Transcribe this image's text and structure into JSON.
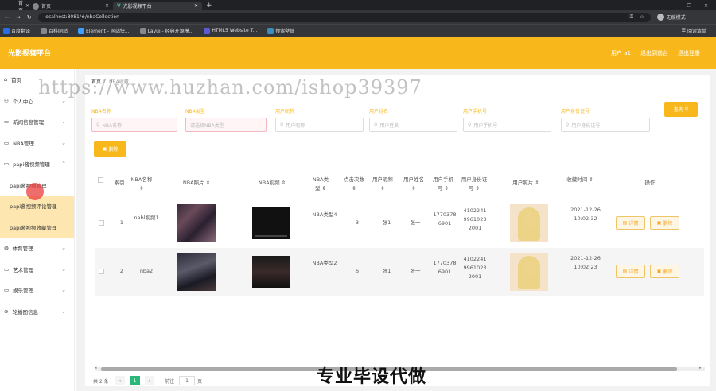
{
  "browser": {
    "tabs": [
      {
        "label": "首页"
      },
      {
        "label": "首页"
      },
      {
        "label": "光影视频平台"
      }
    ],
    "url": "localhost:8081/#/nbaCollection",
    "incognito": "无痕模式",
    "bookmarks": [
      {
        "label": "百度翻译"
      },
      {
        "label": "百科网站"
      },
      {
        "label": "Element - 网站快..."
      },
      {
        "label": "Layui - 经典开源模..."
      },
      {
        "label": "HTML5 Website T..."
      },
      {
        "label": "搜索壁纸"
      }
    ],
    "reading_list": "阅读清单"
  },
  "header": {
    "brand": "光影视频平台",
    "user": "用户 a1",
    "back": "退出到前台",
    "logout": "退出登录"
  },
  "sidebar": [
    {
      "label": "首页"
    },
    {
      "label": "个人中心"
    },
    {
      "label": "新闻信息管理"
    },
    {
      "label": "NBA管理"
    },
    {
      "label": "papi酱视频管理"
    },
    {
      "label": "papi酱视频管理"
    },
    {
      "label": "papi酱视频评论管理"
    },
    {
      "label": "papi酱视频收藏管理"
    },
    {
      "label": "体育管理"
    },
    {
      "label": "艺术管理"
    },
    {
      "label": "娱乐管理"
    },
    {
      "label": "轮播图信息"
    }
  ],
  "breadcrumb": {
    "home": "首页",
    "current": "NBA收藏"
  },
  "watermark": "https://www.huzhan.com/ishop39397",
  "caption": "专业毕设代做",
  "filters": [
    {
      "label": "NBA名称",
      "placeholder": "NBA名称"
    },
    {
      "label": "NBA类型",
      "placeholder": "请选择NBA类型"
    },
    {
      "label": "用户昵称",
      "placeholder": "用户昵称"
    },
    {
      "label": "用户姓名",
      "placeholder": "用户姓名"
    },
    {
      "label": "用户手机号",
      "placeholder": "用户手机号"
    },
    {
      "label": "用户身份证号",
      "placeholder": "用户身份证号"
    }
  ],
  "buttons": {
    "query": "查询",
    "delete": "删除",
    "detail": "详情",
    "row_delete": "删除"
  },
  "table": {
    "headers": [
      {
        "t": "索引"
      },
      {
        "t": "NBA名称"
      },
      {
        "t": "NBA照片"
      },
      {
        "t": "NBA视频"
      },
      {
        "t": "NBA类型"
      },
      {
        "t": "点击次数"
      },
      {
        "t": "用户昵称"
      },
      {
        "t": "用户姓名"
      },
      {
        "t": "用户手机号"
      },
      {
        "t": "用户身份证号"
      },
      {
        "t": "用户照片"
      },
      {
        "t": "收藏时间"
      },
      {
        "t": "操作"
      }
    ],
    "rows": [
      {
        "index": "1",
        "name": "nabl视频1",
        "type": "NBA类型4",
        "clicks": "3",
        "nickname": "张1",
        "realname": "张一",
        "phone": "17703786901",
        "idcard": "410224199610232001",
        "time": "2021-12-26 10:02:32"
      },
      {
        "index": "2",
        "name": "nba2",
        "type": "NBA类型2",
        "clicks": "6",
        "nickname": "张1",
        "realname": "张一",
        "phone": "17703786901",
        "idcard": "410224199610232001",
        "time": "2021-12-26 10:02:23"
      }
    ]
  },
  "pagination": {
    "total": "共 2 条",
    "page": "1",
    "goto": "前往",
    "goto_value": "1",
    "suffix": "页"
  },
  "colors": {
    "accent": "#f8b81c"
  }
}
